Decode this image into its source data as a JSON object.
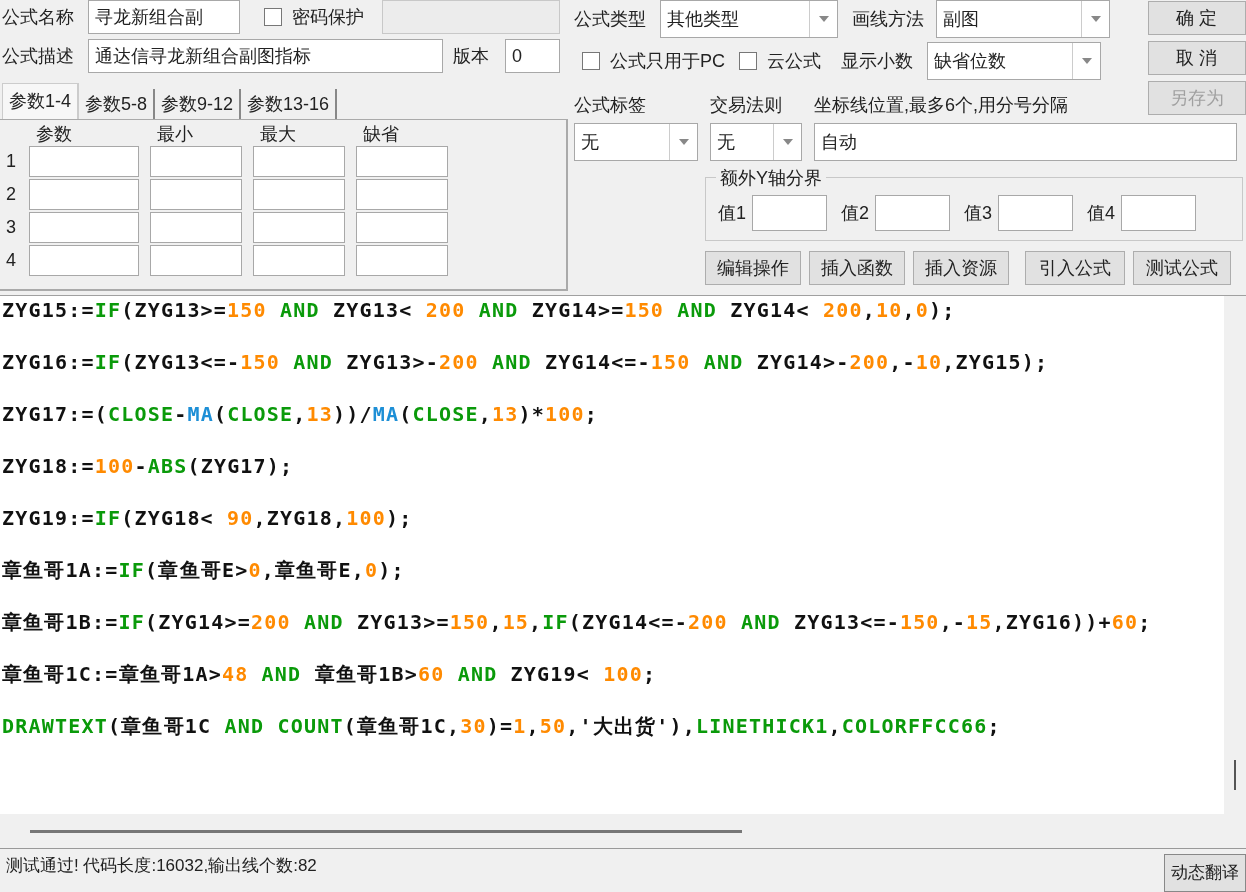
{
  "formula_name": {
    "label": "公式名称",
    "value": "寻龙新组合副"
  },
  "password_protect": {
    "label": "密码保护",
    "checked": false
  },
  "description": {
    "label": "公式描述",
    "value": "通达信寻龙新组合副图指标"
  },
  "version": {
    "label": "版本",
    "value": "0"
  },
  "param_tabs": [
    {
      "label": "参数1-4",
      "selected": true
    },
    {
      "label": "参数5-8",
      "selected": false
    },
    {
      "label": "参数9-12",
      "selected": false
    },
    {
      "label": "参数13-16",
      "selected": false
    }
  ],
  "param_table": {
    "columns": [
      "参数",
      "最小",
      "最大",
      "缺省"
    ],
    "rows": [
      "1",
      "2",
      "3",
      "4"
    ]
  },
  "formula_type": {
    "label": "公式类型",
    "value": "其他类型"
  },
  "draw_method": {
    "label": "画线方法",
    "value": "副图"
  },
  "options": [
    {
      "label": "公式只用于PC",
      "checked": false
    },
    {
      "label": "云公式",
      "checked": false
    }
  ],
  "decimals": {
    "label": "显示小数",
    "value": "缺省位数"
  },
  "side_buttons": [
    {
      "label": "确 定",
      "disabled": false
    },
    {
      "label": "取 消",
      "disabled": false
    },
    {
      "label": "另存为",
      "disabled": true
    }
  ],
  "formula_tag": {
    "label": "公式标签",
    "value": "无"
  },
  "trade_rule": {
    "label": "交易法则",
    "value": "无"
  },
  "axis_lines": {
    "label": "坐标线位置,最多6个,用分号分隔",
    "value": "自动"
  },
  "extra_y_axis": {
    "title": "额外Y轴分界",
    "fields": [
      {
        "label": "值1"
      },
      {
        "label": "值2"
      },
      {
        "label": "值3"
      },
      {
        "label": "值4"
      }
    ]
  },
  "action_buttons": [
    "编辑操作",
    "插入函数",
    "插入资源",
    "引入公式",
    "测试公式"
  ],
  "code_lines": [
    [
      {
        "kind": "plain",
        "text": "ZYG15:="
      },
      {
        "kind": "keyword",
        "text": "IF"
      },
      {
        "kind": "plain",
        "text": "(ZYG13>="
      },
      {
        "kind": "number",
        "text": "150"
      },
      {
        "kind": "keyword",
        "text": " AND"
      },
      {
        "kind": "plain",
        "text": " ZYG13< "
      },
      {
        "kind": "number",
        "text": "200"
      },
      {
        "kind": "keyword",
        "text": " AND"
      },
      {
        "kind": "plain",
        "text": " ZYG14>="
      },
      {
        "kind": "number",
        "text": "150"
      },
      {
        "kind": "keyword",
        "text": " AND"
      },
      {
        "kind": "plain",
        "text": " ZYG14< "
      },
      {
        "kind": "number",
        "text": "200"
      },
      {
        "kind": "plain",
        "text": ","
      },
      {
        "kind": "number",
        "text": "10"
      },
      {
        "kind": "plain",
        "text": ","
      },
      {
        "kind": "number",
        "text": "0"
      },
      {
        "kind": "plain",
        "text": ");"
      }
    ],
    [
      {
        "kind": "plain",
        "text": "ZYG16:="
      },
      {
        "kind": "keyword",
        "text": "IF"
      },
      {
        "kind": "plain",
        "text": "(ZYG13<=-"
      },
      {
        "kind": "number",
        "text": "150"
      },
      {
        "kind": "keyword",
        "text": " AND"
      },
      {
        "kind": "plain",
        "text": " ZYG13>-"
      },
      {
        "kind": "number",
        "text": "200"
      },
      {
        "kind": "keyword",
        "text": " AND"
      },
      {
        "kind": "plain",
        "text": " ZYG14<=-"
      },
      {
        "kind": "number",
        "text": "150"
      },
      {
        "kind": "keyword",
        "text": " AND"
      },
      {
        "kind": "plain",
        "text": " ZYG14>-"
      },
      {
        "kind": "number",
        "text": "200"
      },
      {
        "kind": "plain",
        "text": ",-"
      },
      {
        "kind": "number",
        "text": "10"
      },
      {
        "kind": "plain",
        "text": ",ZYG15);"
      }
    ],
    [
      {
        "kind": "plain",
        "text": "ZYG17:=("
      },
      {
        "kind": "keyword",
        "text": "CLOSE"
      },
      {
        "kind": "plain",
        "text": "-"
      },
      {
        "kind": "builtin",
        "text": "MA"
      },
      {
        "kind": "plain",
        "text": "("
      },
      {
        "kind": "keyword",
        "text": "CLOSE"
      },
      {
        "kind": "plain",
        "text": ","
      },
      {
        "kind": "number",
        "text": "13"
      },
      {
        "kind": "plain",
        "text": "))/"
      },
      {
        "kind": "builtin",
        "text": "MA"
      },
      {
        "kind": "plain",
        "text": "("
      },
      {
        "kind": "keyword",
        "text": "CLOSE"
      },
      {
        "kind": "plain",
        "text": ","
      },
      {
        "kind": "number",
        "text": "13"
      },
      {
        "kind": "plain",
        "text": ")*"
      },
      {
        "kind": "number",
        "text": "100"
      },
      {
        "kind": "plain",
        "text": ";"
      }
    ],
    [
      {
        "kind": "plain",
        "text": "ZYG18:="
      },
      {
        "kind": "number",
        "text": "100"
      },
      {
        "kind": "plain",
        "text": "-"
      },
      {
        "kind": "keyword",
        "text": "ABS"
      },
      {
        "kind": "plain",
        "text": "(ZYG17);"
      }
    ],
    [
      {
        "kind": "plain",
        "text": "ZYG19:="
      },
      {
        "kind": "keyword",
        "text": "IF"
      },
      {
        "kind": "plain",
        "text": "(ZYG18< "
      },
      {
        "kind": "number",
        "text": "90"
      },
      {
        "kind": "plain",
        "text": ",ZYG18,"
      },
      {
        "kind": "number",
        "text": "100"
      },
      {
        "kind": "plain",
        "text": ");"
      }
    ],
    [
      {
        "kind": "plain",
        "text": "章鱼哥1A:="
      },
      {
        "kind": "keyword",
        "text": "IF"
      },
      {
        "kind": "plain",
        "text": "(章鱼哥E>"
      },
      {
        "kind": "number",
        "text": "0"
      },
      {
        "kind": "plain",
        "text": ",章鱼哥E,"
      },
      {
        "kind": "number",
        "text": "0"
      },
      {
        "kind": "plain",
        "text": ");"
      }
    ],
    [
      {
        "kind": "plain",
        "text": "章鱼哥1B:="
      },
      {
        "kind": "keyword",
        "text": "IF"
      },
      {
        "kind": "plain",
        "text": "(ZYG14>="
      },
      {
        "kind": "number",
        "text": "200"
      },
      {
        "kind": "keyword",
        "text": " AND"
      },
      {
        "kind": "plain",
        "text": " ZYG13>="
      },
      {
        "kind": "number",
        "text": "150"
      },
      {
        "kind": "plain",
        "text": ","
      },
      {
        "kind": "number",
        "text": "15"
      },
      {
        "kind": "plain",
        "text": ","
      },
      {
        "kind": "keyword",
        "text": "IF"
      },
      {
        "kind": "plain",
        "text": "(ZYG14<=-"
      },
      {
        "kind": "number",
        "text": "200"
      },
      {
        "kind": "keyword",
        "text": " AND"
      },
      {
        "kind": "plain",
        "text": " ZYG13<=-"
      },
      {
        "kind": "number",
        "text": "150"
      },
      {
        "kind": "plain",
        "text": ",-"
      },
      {
        "kind": "number",
        "text": "15"
      },
      {
        "kind": "plain",
        "text": ",ZYG16))+"
      },
      {
        "kind": "number",
        "text": "60"
      },
      {
        "kind": "plain",
        "text": ";"
      }
    ],
    [
      {
        "kind": "plain",
        "text": "章鱼哥1C:=章鱼哥1A>"
      },
      {
        "kind": "number",
        "text": "48"
      },
      {
        "kind": "keyword",
        "text": " AND"
      },
      {
        "kind": "plain",
        "text": " 章鱼哥1B>"
      },
      {
        "kind": "number",
        "text": "60"
      },
      {
        "kind": "keyword",
        "text": " AND"
      },
      {
        "kind": "plain",
        "text": " ZYG19< "
      },
      {
        "kind": "number",
        "text": "100"
      },
      {
        "kind": "plain",
        "text": ";"
      }
    ],
    [
      {
        "kind": "keyword",
        "text": "DRAWTEXT"
      },
      {
        "kind": "plain",
        "text": "(章鱼哥1C "
      },
      {
        "kind": "keyword",
        "text": "AND "
      },
      {
        "kind": "keyword",
        "text": "COUNT"
      },
      {
        "kind": "plain",
        "text": "(章鱼哥1C,"
      },
      {
        "kind": "number",
        "text": "30"
      },
      {
        "kind": "plain",
        "text": ")="
      },
      {
        "kind": "number",
        "text": "1"
      },
      {
        "kind": "plain",
        "text": ","
      },
      {
        "kind": "number",
        "text": "50"
      },
      {
        "kind": "plain",
        "text": ",'大出货'),"
      },
      {
        "kind": "keyword",
        "text": "LINETHICK1"
      },
      {
        "kind": "plain",
        "text": ","
      },
      {
        "kind": "keyword",
        "text": "COLORFFCC66"
      },
      {
        "kind": "plain",
        "text": ";"
      }
    ]
  ],
  "status_bar": {
    "text": "测试通过! 代码长度:16032,输出线个数:82",
    "button": "动态翻译"
  }
}
